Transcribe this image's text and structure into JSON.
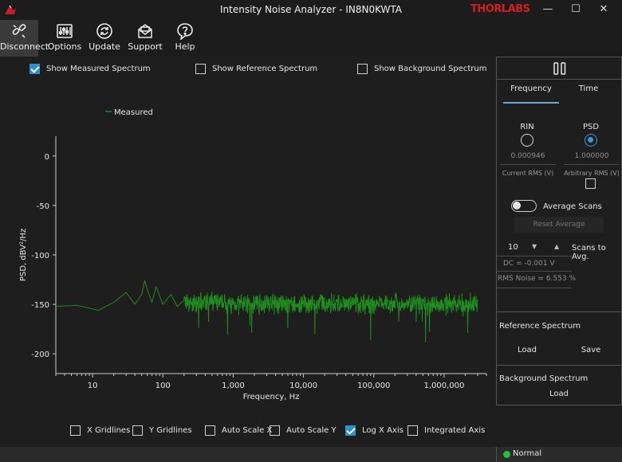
{
  "window": {
    "title": "Intensity Noise Analyzer - IN8N0KWTA",
    "brand": "THORLABS",
    "min_glyph": "—",
    "max_glyph": "☐",
    "close_glyph": "✕"
  },
  "toolbar": {
    "items": [
      {
        "label": "Disconnect",
        "icon": "unlink-icon"
      },
      {
        "label": "Options",
        "icon": "sliders-icon"
      },
      {
        "label": "Update",
        "icon": "refresh-icon"
      },
      {
        "label": "Support",
        "icon": "mail-icon"
      },
      {
        "label": "Help",
        "icon": "help-icon"
      }
    ]
  },
  "top_options": {
    "measured": {
      "label": "Show Measured Spectrum",
      "checked": true
    },
    "reference": {
      "label": "Show Reference Spectrum",
      "checked": false
    },
    "background": {
      "label": "Show Background Spectrum",
      "checked": false
    }
  },
  "bottom_options": {
    "x_gridlines": {
      "label": "X Gridlines",
      "checked": false
    },
    "y_gridlines": {
      "label": "Y Gridlines",
      "checked": false
    },
    "auto_x": {
      "label": "Auto Scale X",
      "checked": false
    },
    "auto_y": {
      "label": "Auto Scale Y",
      "checked": false
    },
    "log_x": {
      "label": "Log X Axis",
      "checked": true
    },
    "integrated": {
      "label": "Integrated Axis",
      "checked": false
    }
  },
  "chart_data": {
    "type": "line",
    "ylabel": "PSD, dBV²/Hz",
    "xlabel": "Frequency, Hz",
    "xscale": "log",
    "xlim": [
      3,
      4000000
    ],
    "ylim": [
      -220,
      20
    ],
    "x_ticks": [
      10,
      100,
      1000,
      10000,
      100000,
      1000000
    ],
    "x_tick_labels": [
      "10",
      "100",
      "1,000",
      "10,000",
      "100,000",
      "1,000,000"
    ],
    "y_ticks": [
      0,
      -50,
      -100,
      -150,
      -200
    ],
    "y_tick_labels": [
      "0",
      "-50",
      "-100",
      "-150",
      "-200"
    ],
    "grid": false,
    "legend_position": "top-left",
    "series": [
      {
        "name": "Measured",
        "color": "#1e8c1e",
        "x": [
          3,
          6,
          12,
          20,
          30,
          40,
          50,
          55,
          60,
          70,
          80,
          100,
          130,
          160,
          200,
          300,
          500,
          1000,
          2000,
          5000,
          10000,
          20000,
          50000,
          100000,
          200000,
          500000,
          1000000,
          2000000,
          3000000
        ],
        "y": [
          -152,
          -151,
          -156,
          -148,
          -138,
          -150,
          -140,
          -126,
          -135,
          -148,
          -132,
          -150,
          -140,
          -152,
          -146,
          -150,
          -148,
          -150,
          -149,
          -150,
          -150,
          -149,
          -150,
          -150,
          -149,
          -150,
          -150,
          -149,
          -150
        ],
        "noise_band_db": 12
      }
    ]
  },
  "panel": {
    "tabs": [
      {
        "label": "Frequency",
        "active": true
      },
      {
        "label": "Time",
        "active": false
      }
    ],
    "rin": {
      "label": "RIN",
      "selected": false,
      "value": "0.000946",
      "caption": "Current RMS (V)"
    },
    "psd": {
      "label": "PSD",
      "selected": true,
      "value": "1.000000",
      "caption": "Arbitrary RMS (V)"
    },
    "average_scans": {
      "label": "Average Scans",
      "on": false
    },
    "reset_average": "Reset Average",
    "scans": {
      "value": "10",
      "label": "Scans to Avg."
    },
    "dc": "DC = -0.001 V",
    "rms_noise": "RMS Noise = 6.553 %",
    "reference": {
      "title": "Reference Spectrum",
      "load": "Load",
      "save": "Save"
    },
    "background": {
      "title": "Background Spectrum",
      "load": "Load"
    }
  },
  "status": {
    "text": "Normal",
    "color": "#22c03a"
  }
}
